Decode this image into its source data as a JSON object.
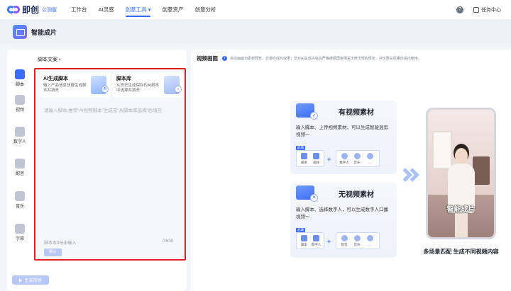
{
  "topnav": {
    "logo_text": "即创",
    "logo_badge": "公测版",
    "items": [
      "工作台",
      "AI灵感",
      "创意工具",
      "创意资产",
      "创意分析"
    ],
    "active_index": 2,
    "active_suffix": "▾",
    "help_glyph": "?",
    "task_center": "任务中心"
  },
  "page": {
    "title": "智能成片"
  },
  "rail": {
    "items": [
      {
        "label": "脚本",
        "icon": "script-icon"
      },
      {
        "label": "视频",
        "icon": "video-icon"
      },
      {
        "label": "数字人",
        "icon": "digital-human-icon"
      },
      {
        "label": "配音",
        "icon": "dubbing-icon"
      },
      {
        "label": "音乐",
        "icon": "music-icon"
      },
      {
        "label": "字幕",
        "icon": "subtitle-icon"
      }
    ]
  },
  "script": {
    "label": "脚本文案",
    "required_mark": "•",
    "cards": [
      {
        "title": "AI生成脚本",
        "desc": "输入产品信息快捷生成脚本并填充",
        "badge": "AI"
      },
      {
        "title": "脚本库",
        "desc": "从历史生成保存的AI脚本中选择并填充",
        "badge": "⌕"
      }
    ],
    "placeholder": "请输入脚本,推荐“AI视频脚本”生成或“从脚本库选择”后填充",
    "sentence_count": "脚本本0句未输入",
    "char_count": "0/600",
    "confirm_label": "确认"
  },
  "generate_button": "生成视频",
  "preview": {
    "title": "视频画面",
    "info_glyph": "i",
    "note": "当前画面为素材预览，非最终成片效果；您对AI生成内容应严格遵循国家相关法律法规的规定，并仅限在巨量体系内使用。",
    "scenarios": [
      {
        "title": "有视频素材",
        "desc": "输入脚本、上传视频素材，可以生成智能混剪视频～",
        "step_tag": "必填",
        "badge": "✓",
        "required": [
          "脚本",
          "视频"
        ],
        "optional": [
          "数字人",
          "音乐",
          "…"
        ]
      },
      {
        "title": "无视频素材",
        "desc": "输入脚本、选择数字人，可以生成数字人口播视频～",
        "step_tag": "必填",
        "badge": "✕",
        "required": [
          "脚本",
          "数字人"
        ],
        "optional": [
          "配音",
          "音乐",
          "…"
        ]
      }
    ],
    "phone_caption": "智能成片",
    "tagline": "多场景匹配 生成不同视频内容"
  },
  "colors": {
    "accent": "#2f6bff",
    "highlight_border": "#e02020"
  }
}
